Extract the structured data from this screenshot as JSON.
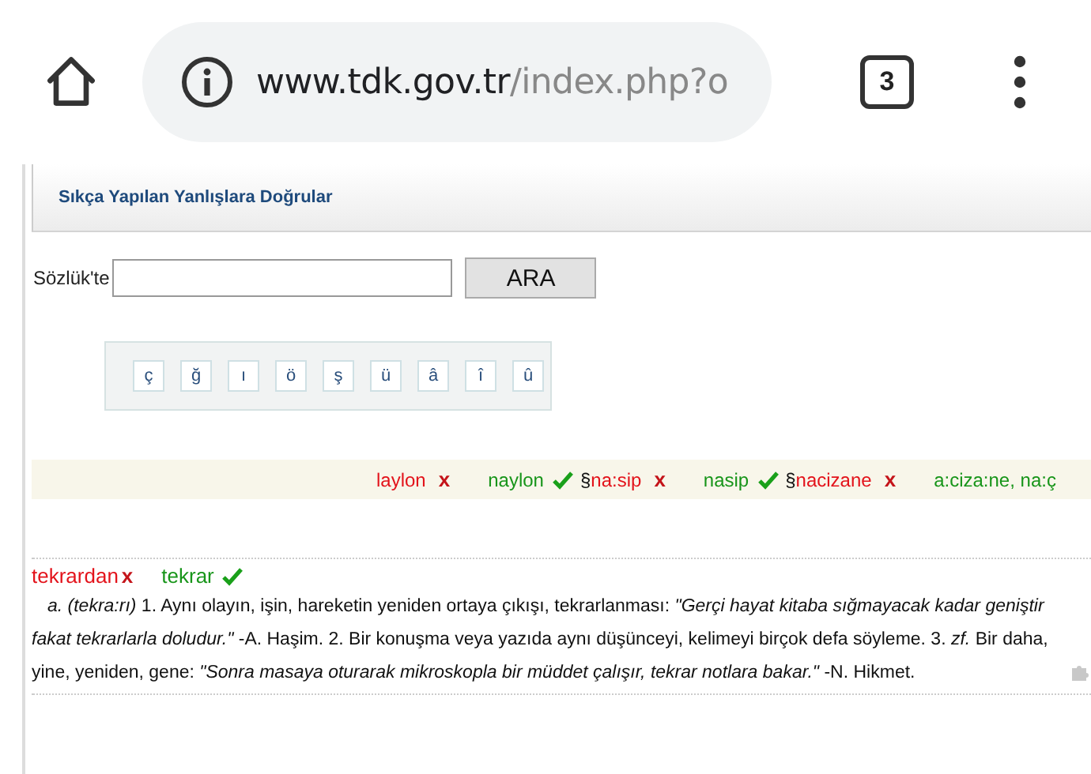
{
  "browser": {
    "url_host": "www.tdk.gov.tr",
    "url_path": "/index.php?o",
    "tab_count": "3"
  },
  "header": {
    "title": "Sıkça Yapılan Yanlışlara Doğrular"
  },
  "search": {
    "label": "Sözlük'te",
    "button": "ARA"
  },
  "special_keys": [
    "ç",
    "ğ",
    "ı",
    "ö",
    "ş",
    "ü",
    "â",
    "î",
    "û"
  ],
  "ticker": [
    {
      "kind": "wrong",
      "text": "laylon",
      "marker": "x"
    },
    {
      "kind": "right",
      "text": "naylon"
    },
    {
      "kind": "mark",
      "text": "§"
    },
    {
      "kind": "wrong",
      "text": "na:sip",
      "marker": "x"
    },
    {
      "kind": "right",
      "text": "nasip"
    },
    {
      "kind": "mark",
      "text": "§"
    },
    {
      "kind": "wrong",
      "text": "nacizane",
      "marker": "x"
    },
    {
      "kind": "right",
      "text": "a:ciza:ne, na:ç"
    }
  ],
  "entry": {
    "wrong": "tekrardan",
    "marker": "x",
    "right": "tekrar",
    "definition": "*a. (tekra:rı)* 1. Aynı olayın, işin, hareketin yeniden ortaya çıkışı, tekrarlanması: *\"Gerçi hayat kitaba sığmayacak kadar geniştir fakat tekrarlarla doludur.\"* -A. Haşim. 2. Bir konuşma veya yazıda aynı düşünceyi, kelimeyi birçok defa söyleme. 3. *zf.* Bir daha, yine, yeniden, gene: *\"Sonra masaya oturarak mikroskopla bir müddet çalışır, tekrar notlara bakar.\"* -N. Hikmet."
  }
}
